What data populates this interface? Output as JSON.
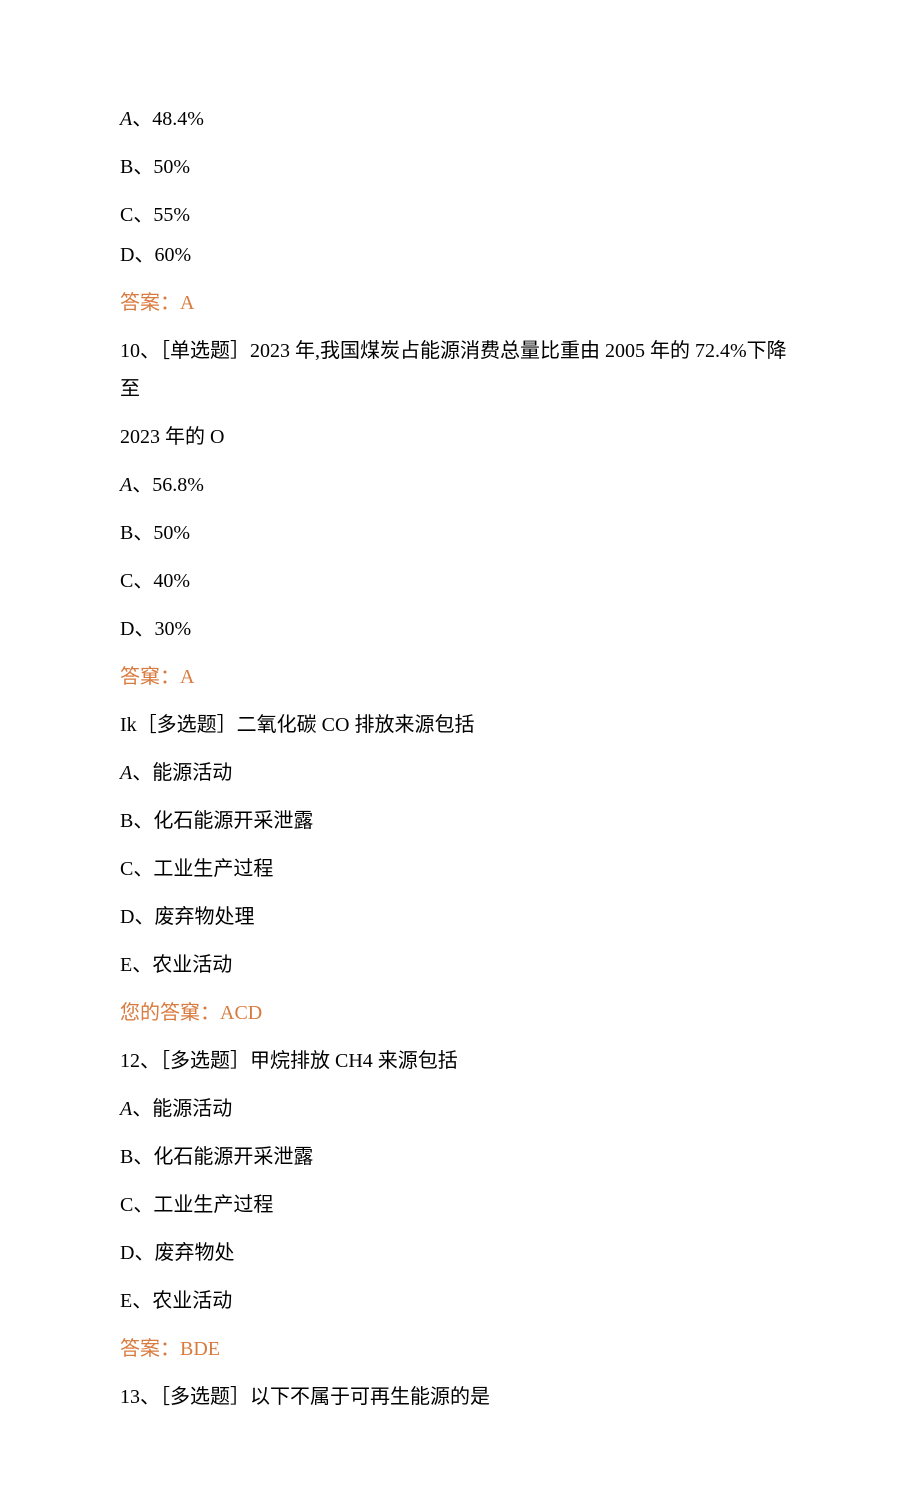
{
  "q9": {
    "optA": "A、48.4%",
    "optB": "B、50%",
    "optC": "C、55%",
    "optD": "D、60%",
    "answer": "答案：A"
  },
  "q10": {
    "stem": "10、［单选题］2023 年,我国煤炭占能源消费总量比重由 2005 年的 72.4%下降至",
    "stem2": "2023 年的 O",
    "optA": "A、56.8%",
    "optB": "B、50%",
    "optC": "C、40%",
    "optD": "D、30%",
    "answer": "答窠：A"
  },
  "q11": {
    "stem": "Ik［多选题］二氧化碳 CO 排放来源包括",
    "optA": "A、能源活动",
    "optB": "B、化石能源开采泄露",
    "optC": "C、工业生产过程",
    "optD": "D、废弃物处理",
    "optE": "E、农业活动",
    "answer": "您的答窠：ACD"
  },
  "q12": {
    "stem": "12、［多选题］甲烷排放 CH4 来源包括",
    "optA": "A、能源活动",
    "optB": "B、化石能源开采泄露",
    "optC": "C、工业生产过程",
    "optD": "D、废弃物处",
    "optE": "E、农业活动",
    "answer": "答案：BDE"
  },
  "q13": {
    "stem": "13、［多选题］以下不属于可再生能源的是"
  }
}
